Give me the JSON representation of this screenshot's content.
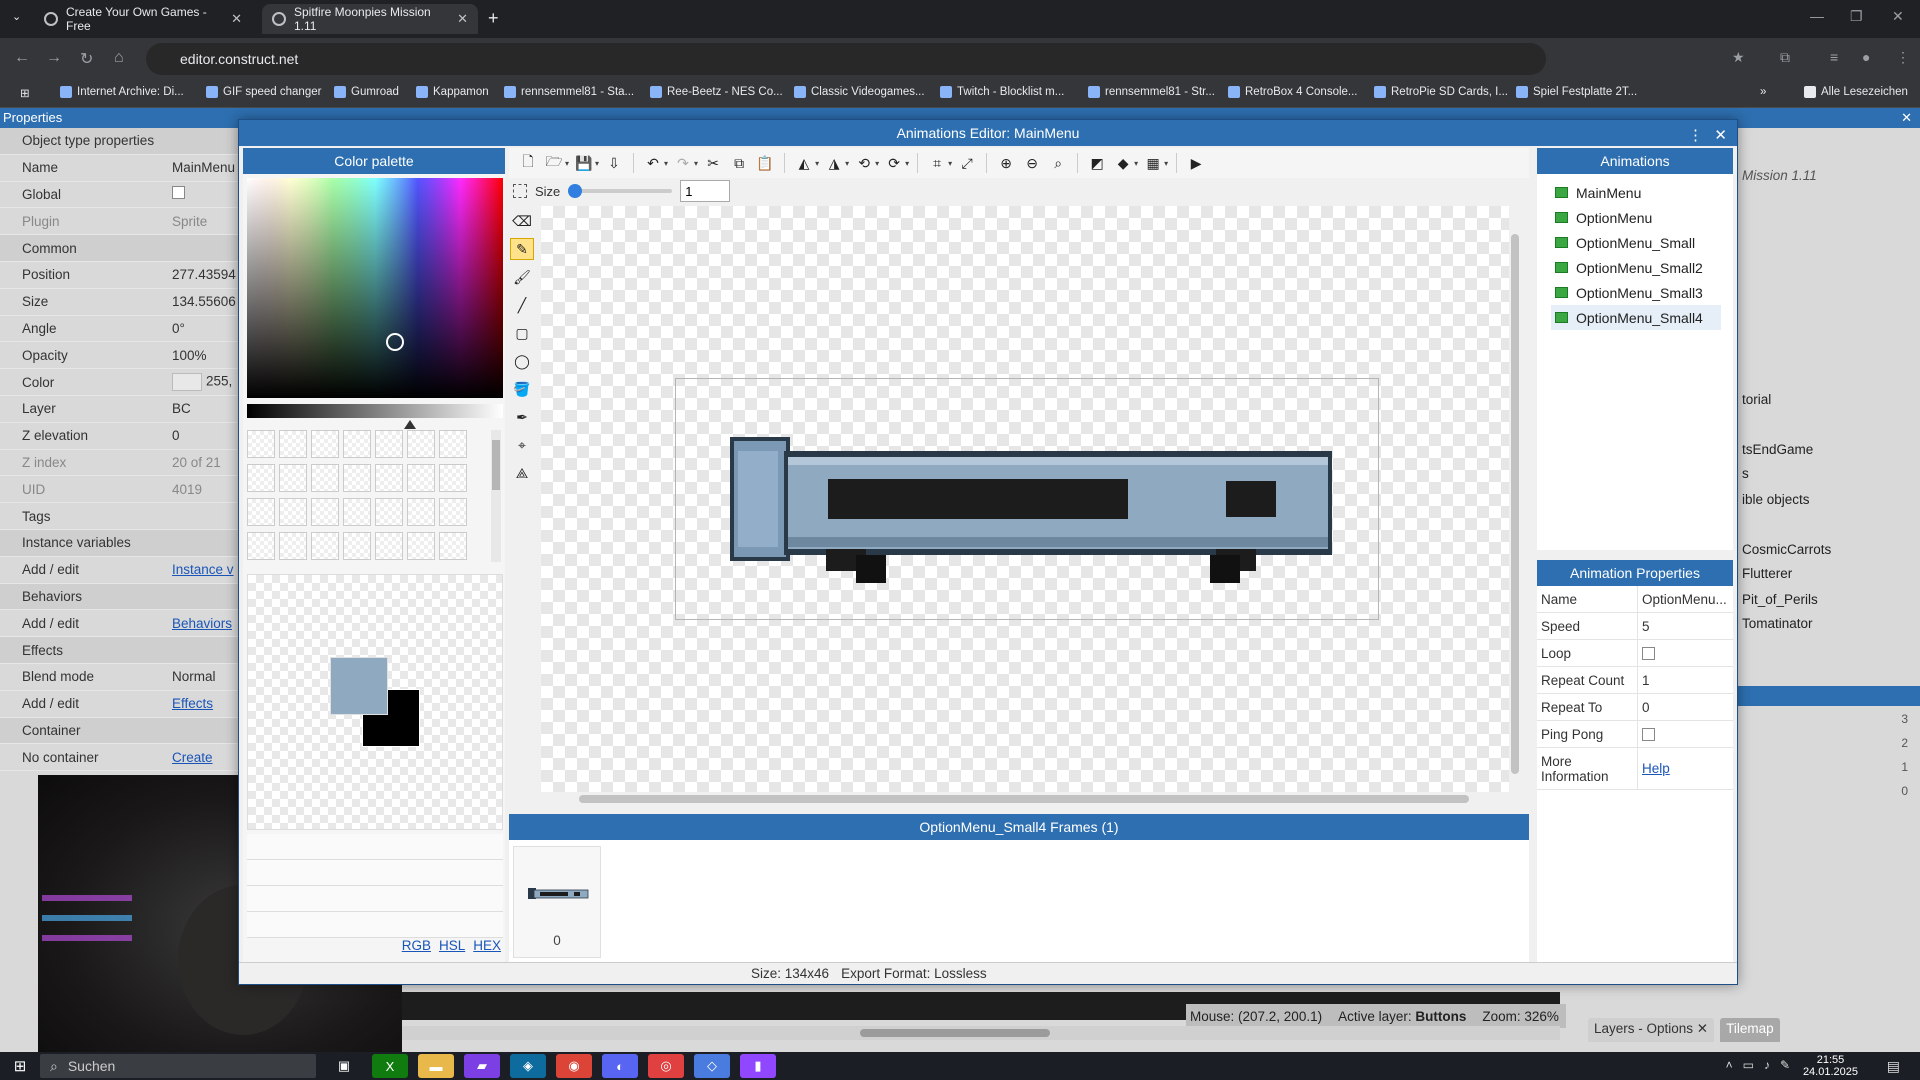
{
  "browser": {
    "tabs": [
      {
        "title": "Create Your Own Games - Free",
        "active": false
      },
      {
        "title": "Spitfire Moonpies Mission 1.11",
        "active": true
      }
    ],
    "url": "editor.construct.net",
    "bookmarks": [
      "Internet Archive: Di...",
      "GIF speed changer",
      "Gumroad",
      "Kappamon",
      "rennsemmel81 - Sta...",
      "Ree-Beetz - NES Co...",
      "Classic Videogames...",
      "Twitch - Blocklist m...",
      "rennsemmel81 - Str...",
      "RetroBox 4 Console...",
      "RetroPie SD Cards, I...",
      "Spiel Festplatte 2T..."
    ],
    "all_bookmarks": "Alle Lesezeichen"
  },
  "properties": {
    "title": "Properties",
    "rows": [
      {
        "k": "Object type properties",
        "section": true
      },
      {
        "k": "Name",
        "v": "MainMenu"
      },
      {
        "k": "Global",
        "v": "",
        "check": true
      },
      {
        "k": "Plugin",
        "v": "Sprite",
        "dim": true
      },
      {
        "k": "Common",
        "section": true
      },
      {
        "k": "Position",
        "v": "277.43594"
      },
      {
        "k": "Size",
        "v": "134.55606"
      },
      {
        "k": "Angle",
        "v": "0°"
      },
      {
        "k": "Opacity",
        "v": "100%"
      },
      {
        "k": "Color",
        "v": "255,",
        "swatch": true
      },
      {
        "k": "Layer",
        "v": "BC"
      },
      {
        "k": "Z elevation",
        "v": "0"
      },
      {
        "k": "Z index",
        "v": "20 of 21",
        "dim": true
      },
      {
        "k": "UID",
        "v": "4019",
        "dim": true
      },
      {
        "k": "Tags",
        "v": ""
      },
      {
        "k": "Instance variables",
        "section": true
      },
      {
        "k": "Add / edit",
        "v": "Instance v",
        "link": true
      },
      {
        "k": "Behaviors",
        "section": true
      },
      {
        "k": "Add / edit",
        "v": "Behaviors",
        "link": true
      },
      {
        "k": "Effects",
        "section": true
      },
      {
        "k": "Blend mode",
        "v": "Normal"
      },
      {
        "k": "Add / edit",
        "v": "Effects",
        "link": true
      },
      {
        "k": "Container",
        "section": true
      },
      {
        "k": "No container",
        "v": "Create",
        "link": true
      }
    ]
  },
  "right_panel": {
    "project_title": "Mission 1.11",
    "items": [
      "torial",
      "tsEndGame",
      "s",
      "ible objects",
      "CosmicCarrots",
      "Flutterer",
      "Pit_of_Perils",
      "Tomatinator"
    ],
    "layer_numbers": [
      "3",
      "2",
      "1",
      "0"
    ]
  },
  "dialog": {
    "title": "Animations Editor: MainMenu",
    "palette_title": "Color palette",
    "color_modes": [
      "RGB",
      "HSL",
      "HEX"
    ],
    "primary_color": "#8fa9c1",
    "secondary_color": "#000000",
    "size_label": "Size",
    "size_value": "1",
    "animations_title": "Animations",
    "animations": [
      "MainMenu",
      "OptionMenu",
      "OptionMenu_Small",
      "OptionMenu_Small2",
      "OptionMenu_Small3",
      "OptionMenu_Small4"
    ],
    "selected_animation": "OptionMenu_Small4",
    "anim_props_title": "Animation Properties",
    "anim_props": [
      {
        "k": "Name",
        "v": "OptionMenu..."
      },
      {
        "k": "Speed",
        "v": "5"
      },
      {
        "k": "Loop",
        "v": "",
        "check": true
      },
      {
        "k": "Repeat Count",
        "v": "1"
      },
      {
        "k": "Repeat To",
        "v": "0"
      },
      {
        "k": "Ping Pong",
        "v": "",
        "check": true
      },
      {
        "k": "More Information",
        "v": "Help",
        "link": true
      }
    ],
    "frames_title": "OptionMenu_Small4 Frames (1)",
    "frame_index": "0",
    "status_size": "Size: 134x46",
    "status_export": "Export Format: Lossless"
  },
  "editor_status": {
    "mouse": "Mouse: (207.2, 200.1)",
    "active_layer_label": "Active layer:",
    "active_layer": "Buttons",
    "zoom": "Zoom: 326%",
    "tabs": [
      "Layers - Options",
      "Tilemap"
    ]
  },
  "taskbar": {
    "search": "Suchen",
    "time": "21:55",
    "date": "24.01.2025"
  }
}
